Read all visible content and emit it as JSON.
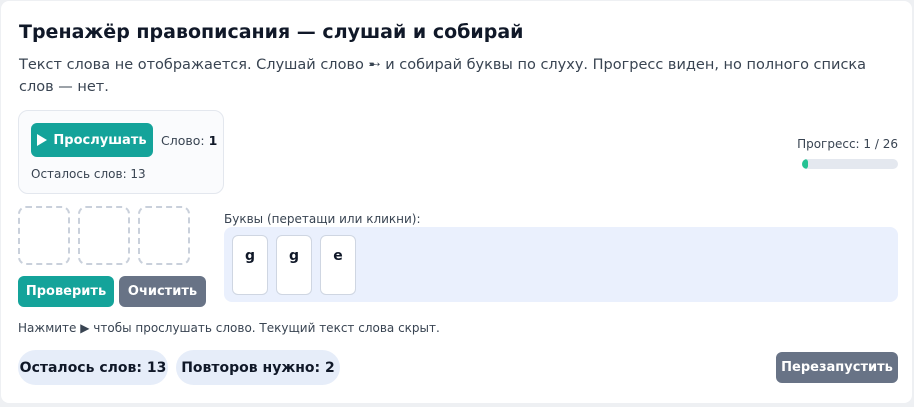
{
  "header": {
    "title": "Тренажёр правописания — слушай и собирай",
    "description": "Текст слова не отображается. Слушай слово ➸ и собирай буквы по слуху. Прогресс виден, но полного списка слов — нет."
  },
  "player": {
    "play_label": "Прослушать",
    "word_label": "Слово:",
    "word_number": "1",
    "remaining_text": "Осталось слов: 13"
  },
  "progress": {
    "text": "Прогресс: 1 / 26",
    "current": 1,
    "total": 26
  },
  "answer_slots": {
    "count": 3
  },
  "actions": {
    "check_label": "Проверить",
    "clear_label": "Очистить"
  },
  "letters": {
    "label": "Буквы (перетащи или кликни):",
    "items": [
      "g",
      "g",
      "e"
    ]
  },
  "hint": "Нажмите ▶ чтобы прослушать слово. Текущий текст слова скрыт.",
  "footer": {
    "remaining_pill": "Осталось слов: 13",
    "repeats_pill": "Повторов нужно: 2",
    "restart_label": "Перезапустить"
  },
  "colors": {
    "accent": "#14a39a",
    "secondary_button": "#687386",
    "progress_fill": "#25c293",
    "tray_background": "#eaf0fd"
  }
}
